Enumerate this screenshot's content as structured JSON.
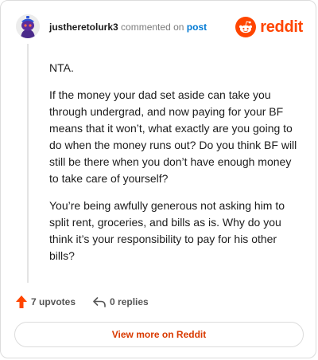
{
  "header": {
    "username": "justheretolurk3",
    "action_text": "commented on",
    "post_link": "post"
  },
  "brand": {
    "wordmark": "reddit",
    "icon": "reddit-alien-icon",
    "color": "#ff4500"
  },
  "avatar": {
    "icon": "snoo-avatar-icon"
  },
  "comment": {
    "paragraphs": [
      "NTA.",
      "If the money your dad set aside can take you through undergrad, and now paying for your BF means that it won’t, what exactly are you going to do when the money runs out? Do you think BF will still be there when you don’t have enough money to take care of yourself?",
      "You’re being awfully generous not asking him to split rent, groceries, and bills as is. Why do you think it’s your responsibility to pay for his other bills?"
    ]
  },
  "actions": {
    "upvotes": "7 upvotes",
    "upvote_icon": "upvote-arrow-icon",
    "replies": "0 replies",
    "reply_icon": "reply-arrow-icon"
  },
  "footer": {
    "view_more": "View more on Reddit"
  }
}
